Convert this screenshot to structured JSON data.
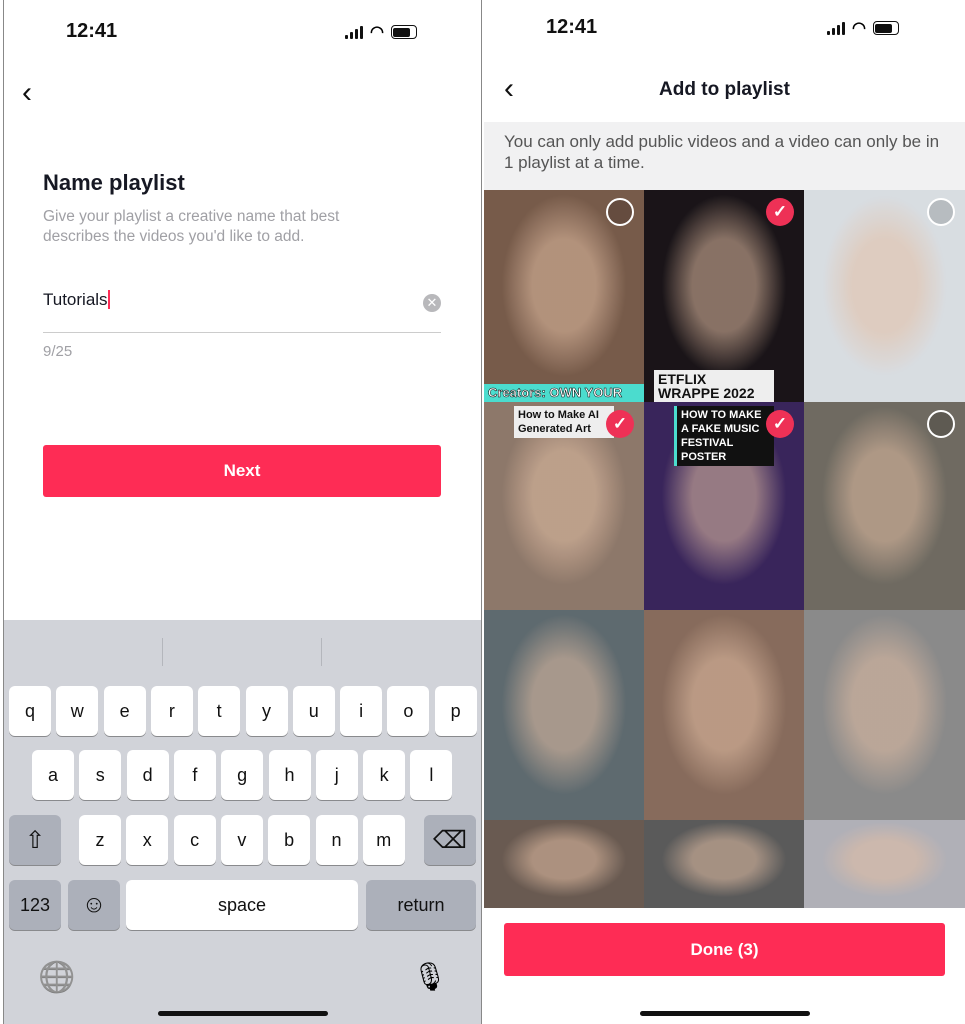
{
  "left": {
    "status": {
      "time": "12:41"
    },
    "title": "Name playlist",
    "subtitle": "Give your playlist a creative name that best describes the videos you'd like to add.",
    "input": {
      "value": "Tutorials"
    },
    "char_count": "9/25",
    "next_label": "Next",
    "keyboard": {
      "row1": [
        "q",
        "w",
        "e",
        "r",
        "t",
        "y",
        "u",
        "i",
        "o",
        "p"
      ],
      "row2": [
        "a",
        "s",
        "d",
        "f",
        "g",
        "h",
        "j",
        "k",
        "l"
      ],
      "row3": [
        "z",
        "x",
        "c",
        "v",
        "b",
        "n",
        "m"
      ],
      "numbers": "123",
      "space": "space",
      "return": "return"
    }
  },
  "right": {
    "status": {
      "time": "12:41"
    },
    "title": "Add to playlist",
    "note": "You can only add public videos and a video can only be in 1 playlist at a time.",
    "videos": [
      {
        "text": "Creators: OWN YOUR",
        "selected": false,
        "bg": "#7a5a48"
      },
      {
        "text": "ETFLIX WRAPPE 2022",
        "selected": true,
        "bg": "#1a1418"
      },
      {
        "text": "",
        "selected": false,
        "bg": "#d8dde2"
      },
      {
        "text": "How to Make AI Generated Art",
        "selected": true,
        "bg": "#8f7868"
      },
      {
        "text": "HOW TO MAKE A FAKE MUSIC FESTIVAL POSTER",
        "selected": true,
        "bg": "#3a2460"
      },
      {
        "text": "",
        "selected": false,
        "bg": "#6f6a60"
      },
      {
        "text": "",
        "selected": false,
        "bg": "#5d6a70"
      },
      {
        "text": "",
        "selected": false,
        "bg": "#8a6a5a"
      },
      {
        "text": "",
        "selected": false,
        "bg": "#8a8a8a"
      },
      {
        "text": "",
        "selected": false,
        "bg": "#6a5a50"
      },
      {
        "text": "",
        "selected": false,
        "bg": "#5a5a5a"
      },
      {
        "text": "",
        "selected": false,
        "bg": "#b0b0b8"
      }
    ],
    "done_label": "Done (3)"
  },
  "accent": "#fe2c55"
}
